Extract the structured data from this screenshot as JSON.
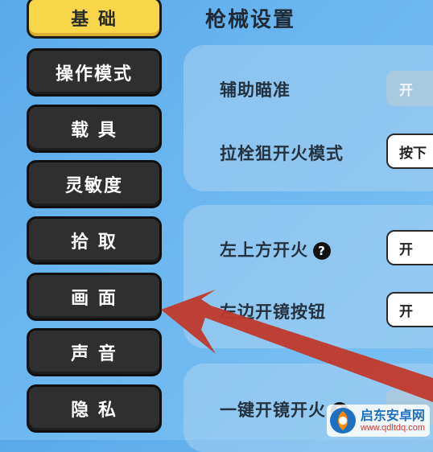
{
  "sidebar": {
    "items": [
      {
        "label": "基 础",
        "active": true
      },
      {
        "label": "操作模式"
      },
      {
        "label": "载 具"
      },
      {
        "label": "灵敏度"
      },
      {
        "label": "拾 取"
      },
      {
        "label": "画 面"
      },
      {
        "label": "声 音"
      },
      {
        "label": "隐 私"
      }
    ]
  },
  "main": {
    "title": "枪械设置",
    "rows": [
      {
        "label": "辅助瞄准",
        "value": "开"
      },
      {
        "label": "拉栓狙开火模式",
        "value": "按下"
      },
      {
        "label": "左上方开火",
        "value": "开"
      },
      {
        "label": "左边开镜按钮",
        "value": "开"
      },
      {
        "label": "一键开镜开火",
        "value": ""
      }
    ]
  },
  "colors": {
    "accent": "#f7d64a",
    "arrow": "#c0392b",
    "nav_bg": "#2f2f2f"
  },
  "watermark": {
    "title": "启东安卓网",
    "url": "www.qdltdq.com"
  }
}
